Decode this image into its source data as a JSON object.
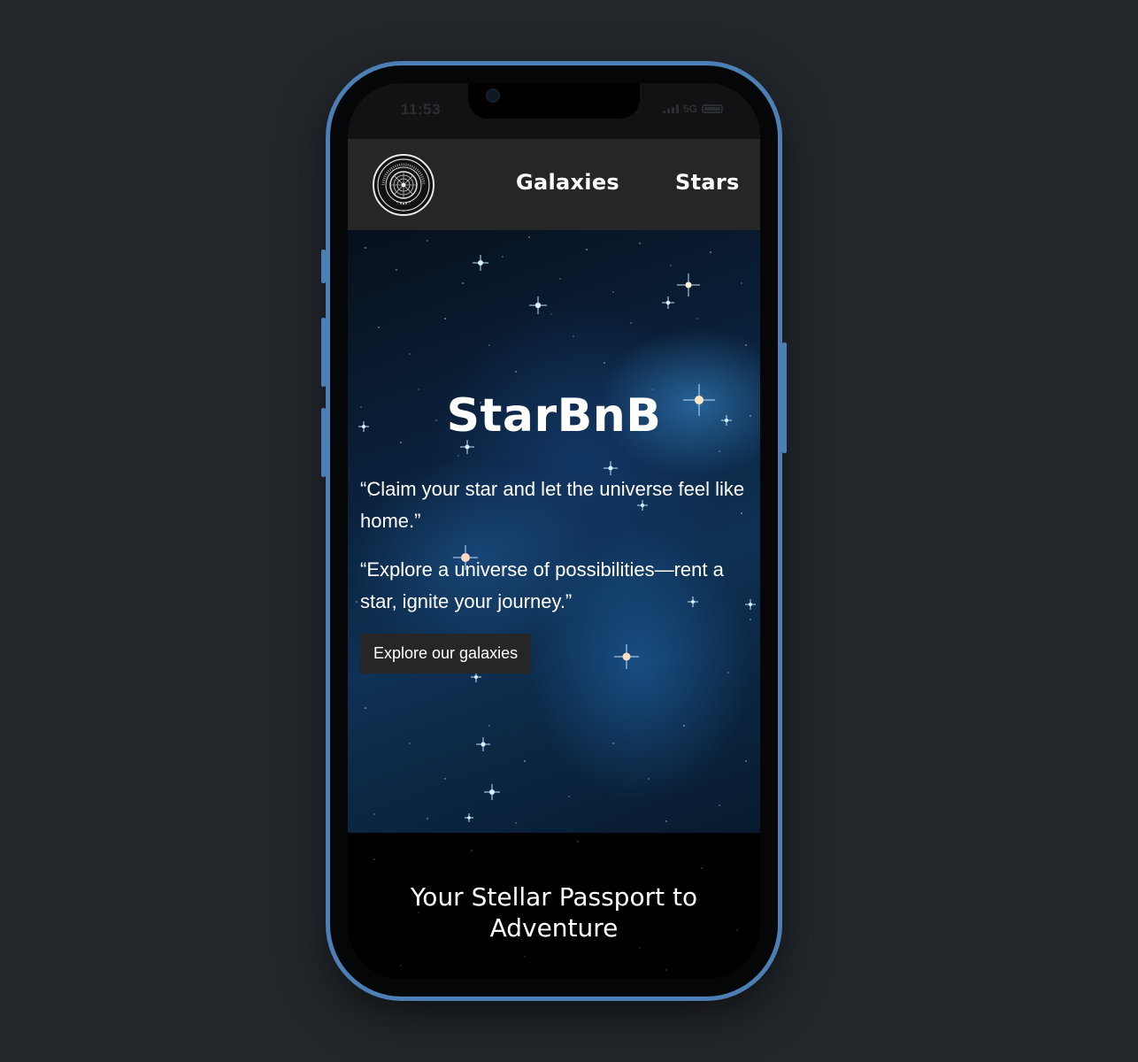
{
  "status_bar": {
    "time": "11:53",
    "network": "5G",
    "signal_icon": "signal-bars-icon",
    "battery_icon": "battery-icon"
  },
  "navbar": {
    "logo_icon": "federation-seal-logo",
    "links": [
      {
        "label": "Galaxies"
      },
      {
        "label": "Stars"
      }
    ]
  },
  "hero": {
    "title": "StarBnB",
    "quotes": [
      "“Claim your star and let the universe feel like home.”",
      "“Explore a universe of possibilities—rent a star, ignite your journey.”"
    ],
    "cta_label": "Explore our galaxies"
  },
  "section": {
    "title": "Your Stellar Passport to Adventure"
  },
  "colors": {
    "page_background": "#23272c",
    "phone_frame": "#4b7fb5",
    "navbar_background": "#262626",
    "cta_background": "#262626",
    "text": "#ffffff"
  }
}
